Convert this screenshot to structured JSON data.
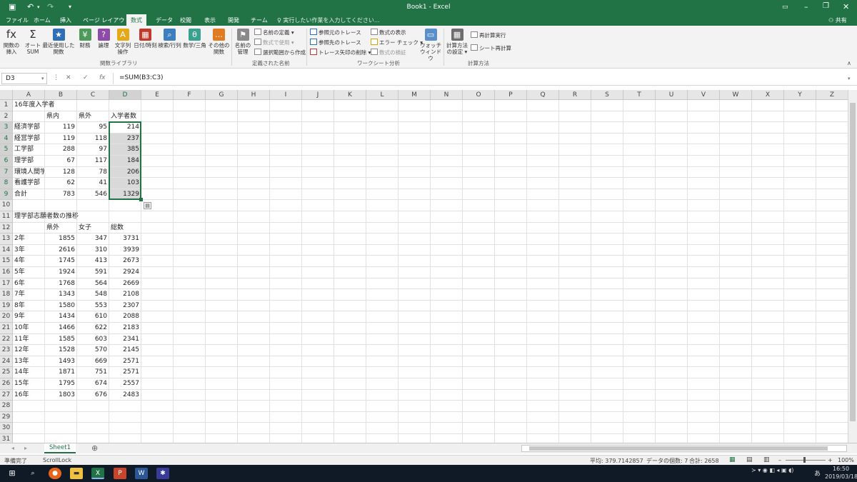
{
  "window": {
    "title": "Book1 - Excel"
  },
  "quick_access": {
    "save_icon": "save-icon",
    "undo_icon": "undo-icon",
    "redo_icon": "redo-icon"
  },
  "menu": {
    "tabs": [
      "ファイル",
      "ホーム",
      "挿入",
      "ページ レイアウト",
      "数式",
      "データ",
      "校閲",
      "表示",
      "開発",
      "チーム"
    ],
    "active": "数式",
    "tell_me": "実行したい作業を入力してください...",
    "share": "共有"
  },
  "ribbon": {
    "function_library": {
      "buttons": [
        {
          "label1": "関数の",
          "label2": "挿入",
          "icon": "fx"
        },
        {
          "label1": "オート",
          "label2": "SUM",
          "icon": "Σ"
        },
        {
          "label1": "最近使用した",
          "label2": "関数",
          "icon": "★"
        },
        {
          "label1": "財務",
          "label2": "",
          "icon": "¥"
        },
        {
          "label1": "論理",
          "label2": "",
          "icon": "?"
        },
        {
          "label1": "文字列",
          "label2": "操作",
          "icon": "A"
        },
        {
          "label1": "日付/時刻",
          "label2": "",
          "icon": "▦"
        },
        {
          "label1": "検索/行列",
          "label2": "",
          "icon": "⌕"
        },
        {
          "label1": "数学/三角",
          "label2": "",
          "icon": "θ"
        },
        {
          "label1": "その他の",
          "label2": "関数",
          "icon": "…"
        }
      ],
      "group_label": "関数ライブラリ"
    },
    "defined_names": {
      "manager_label1": "名前の",
      "manager_label2": "管理",
      "define": "名前の定義",
      "use_in_formula": "数式で使用",
      "create_from_selection": "選択範囲から作成",
      "group_label": "定義された名前"
    },
    "formula_auditing": {
      "trace_precedents": "参照元のトレース",
      "trace_dependents": "参照先のトレース",
      "remove_arrows": "トレース矢印の削除",
      "show_formulas": "数式の表示",
      "error_checking": "エラー チェック",
      "evaluate_formula": "数式の検証",
      "watch_label1": "ウォッチ",
      "watch_label2": "ウィンドウ",
      "group_label": "ワークシート分析"
    },
    "calculation": {
      "options_label1": "計算方法",
      "options_label2": "の設定",
      "calc_now": "再計算実行",
      "calc_sheet": "シート再計算",
      "group_label": "計算方法"
    }
  },
  "formula_bar": {
    "name_box": "D3",
    "formula": "=SUM(B3:C3)"
  },
  "grid": {
    "columns": [
      "A",
      "B",
      "C",
      "D",
      "E",
      "F",
      "G",
      "H",
      "I",
      "J",
      "K",
      "L",
      "M",
      "N",
      "O",
      "P",
      "Q",
      "R",
      "S",
      "T",
      "U",
      "V",
      "W",
      "X",
      "Y",
      "Z"
    ],
    "row_numbers": [
      "1",
      "2",
      "3",
      "4",
      "5",
      "6",
      "7",
      "8",
      "9",
      "10",
      "11",
      "12",
      "13",
      "14",
      "15",
      "16",
      "17",
      "18",
      "19",
      "20",
      "21",
      "22",
      "23",
      "24",
      "25",
      "26",
      "27",
      "28",
      "29",
      "30",
      "31"
    ],
    "rows": [
      [
        "16年度入学者",
        "",
        "",
        ""
      ],
      [
        "",
        "県内",
        "県外",
        "入学者数"
      ],
      [
        "経済学部",
        "119",
        "95",
        "214"
      ],
      [
        "経営学部",
        "119",
        "118",
        "237"
      ],
      [
        "工学部",
        "288",
        "97",
        "385"
      ],
      [
        "理学部",
        "67",
        "117",
        "184"
      ],
      [
        "環境人間学",
        "128",
        "78",
        "206"
      ],
      [
        "看護学部",
        "62",
        "41",
        "103"
      ],
      [
        "合計",
        "783",
        "546",
        "1329"
      ],
      [
        "",
        "",
        "",
        ""
      ],
      [
        "理学部志願者数の推移",
        "",
        "",
        ""
      ],
      [
        "",
        "県外",
        "女子",
        "総数"
      ],
      [
        "2年",
        "1855",
        "347",
        "3731"
      ],
      [
        "3年",
        "2616",
        "310",
        "3939"
      ],
      [
        "4年",
        "1745",
        "413",
        "2673"
      ],
      [
        "5年",
        "1924",
        "591",
        "2924"
      ],
      [
        "6年",
        "1768",
        "564",
        "2669"
      ],
      [
        "7年",
        "1343",
        "548",
        "2108"
      ],
      [
        "8年",
        "1580",
        "553",
        "2307"
      ],
      [
        "9年",
        "1434",
        "610",
        "2088"
      ],
      [
        "10年",
        "1466",
        "622",
        "2183"
      ],
      [
        "11年",
        "1585",
        "603",
        "2341"
      ],
      [
        "12年",
        "1528",
        "570",
        "2145"
      ],
      [
        "13年",
        "1493",
        "669",
        "2571"
      ],
      [
        "14年",
        "1871",
        "751",
        "2571"
      ],
      [
        "15年",
        "1795",
        "674",
        "2557"
      ],
      [
        "16年",
        "1803",
        "676",
        "2483"
      ],
      [
        "",
        "",
        "",
        ""
      ],
      [
        "",
        "",
        "",
        ""
      ],
      [
        "",
        "",
        "",
        ""
      ],
      [
        "",
        "",
        "",
        ""
      ]
    ]
  },
  "sheet_tabs": {
    "active": "Sheet1",
    "add_icon": "plus-icon"
  },
  "status_bar": {
    "ready": "準備完了",
    "scroll_lock": "ScrollLock",
    "average": "平均: 379.7142857",
    "count": "データの個数: 7",
    "sum": "合計: 2658",
    "zoom": "100%"
  },
  "taskbar": {
    "time": "16:50",
    "date": "2019/03/18",
    "ime": "あ"
  }
}
